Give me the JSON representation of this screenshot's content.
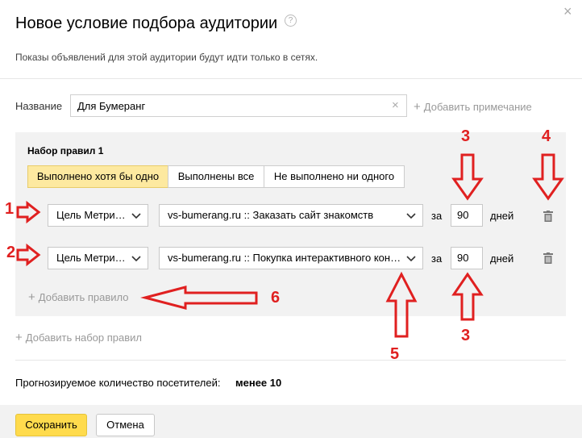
{
  "dialog": {
    "title": "Новое условие подбора аудитории",
    "subtitle": "Показы объявлений для этой аудитории будут идти только в сетях.",
    "help_icon": "?",
    "close_icon": "×"
  },
  "name_field": {
    "label": "Название",
    "value": "Для Бумеранг",
    "add_note": "Добавить примечание"
  },
  "ruleset": {
    "title": "Набор правил 1",
    "modes": [
      "Выполнено хотя бы одно",
      "Выполнены все",
      "Не выполнено ни одного"
    ],
    "active_mode": "Выполнено хотя бы одно",
    "rules": [
      {
        "type": "Цель Метри…",
        "goal": "vs-bumerang.ru :: Заказать сайт знакомств",
        "za": "за",
        "days": "90",
        "days_label": "дней"
      },
      {
        "type": "Цель Метри…",
        "goal": "vs-bumerang.ru :: Покупка интерактивного кон…",
        "za": "за",
        "days": "90",
        "days_label": "дней"
      }
    ],
    "add_rule": "Добавить правило"
  },
  "add_ruleset": "Добавить набор правил",
  "forecast": {
    "label": "Прогнозируемое количество посетителей:",
    "value": "менее 10"
  },
  "footer": {
    "save": "Сохранить",
    "cancel": "Отмена"
  },
  "annotations": {
    "n1": "1",
    "n2": "2",
    "n3a": "3",
    "n3b": "3",
    "n4": "4",
    "n5": "5",
    "n6": "6",
    "color": "#e02020"
  },
  "colors": {
    "accent_yellow": "#ffdb4d",
    "active_segment": "#fde9a0",
    "panel_gray": "#f2f2f2"
  },
  "icons": [
    "help-icon",
    "close-icon",
    "clear-icon",
    "plus-icon",
    "chevron-down-icon",
    "trash-icon"
  ]
}
